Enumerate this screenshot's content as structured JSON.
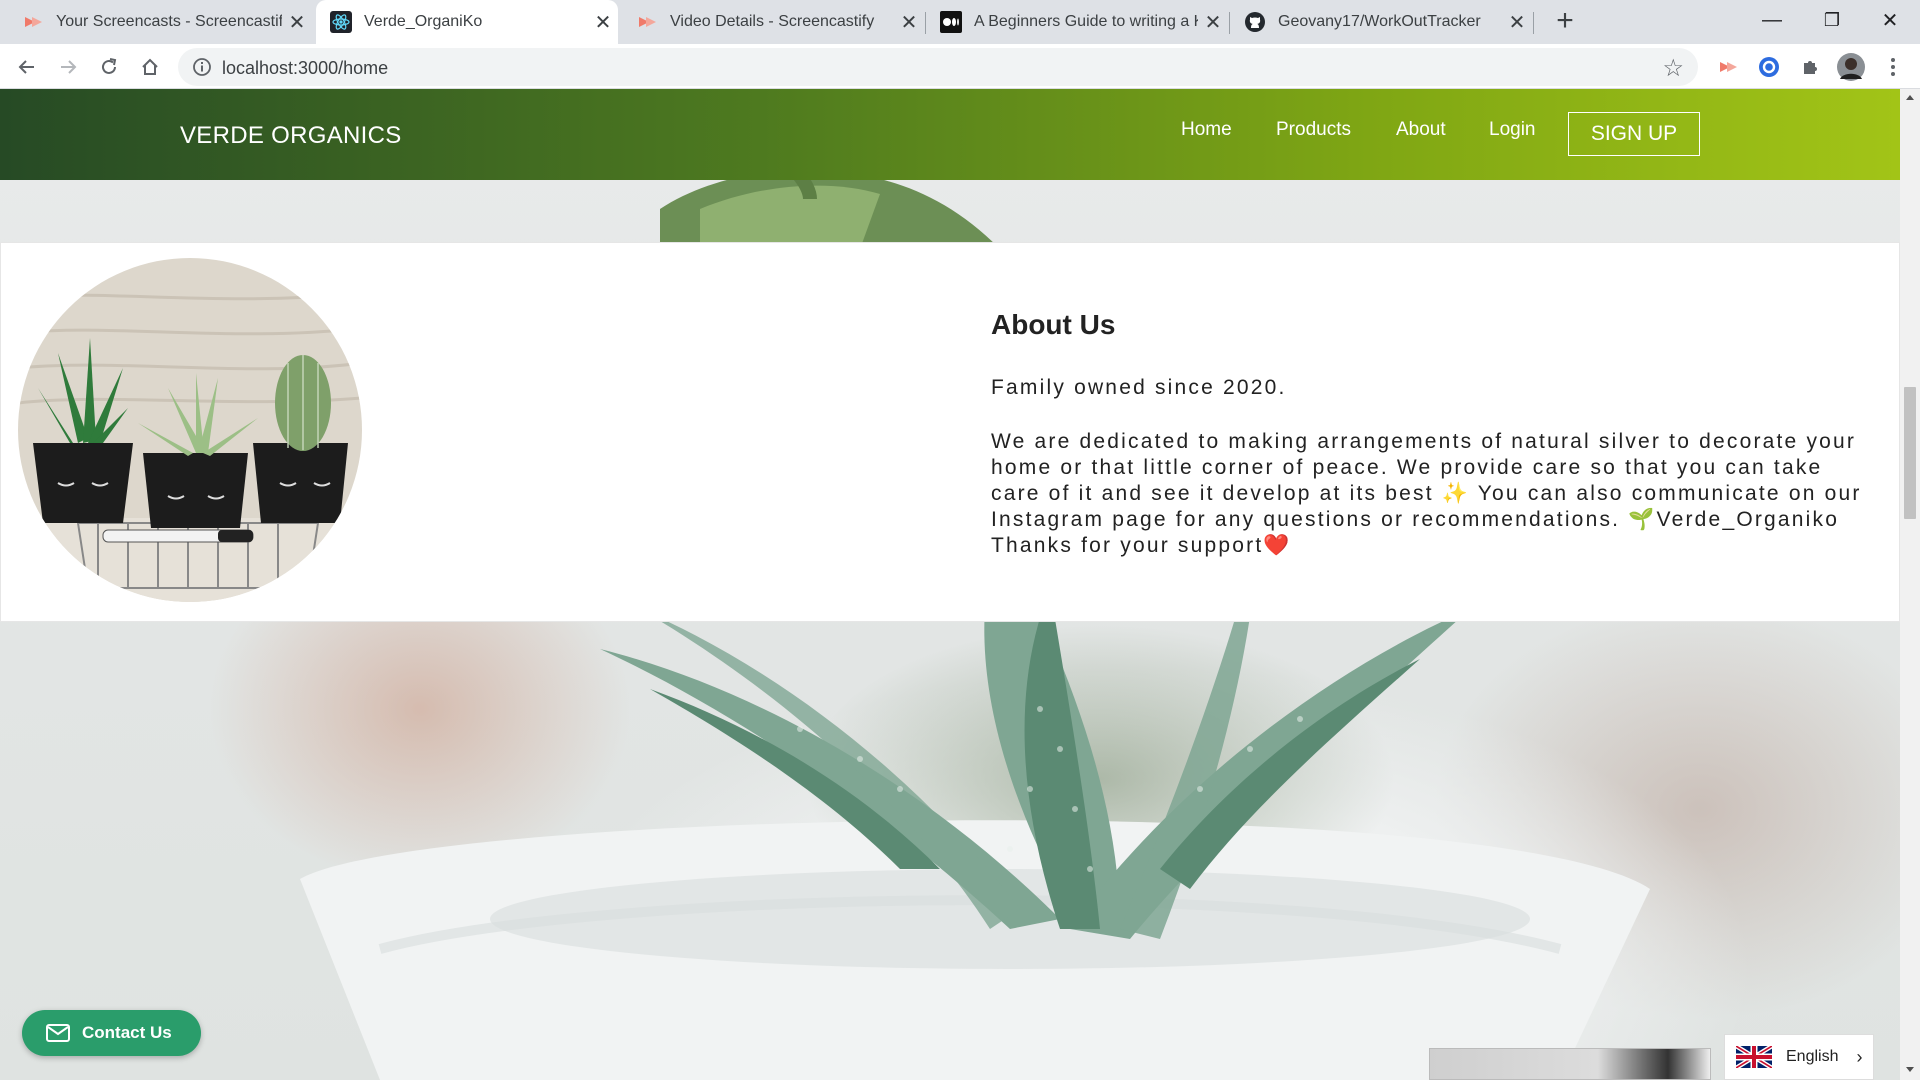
{
  "browser": {
    "tabs": [
      {
        "title": "Your Screencasts - Screencastify",
        "icon": "screencastify-icon",
        "active": false
      },
      {
        "title": "Verde_OrganiKo",
        "icon": "react-icon",
        "active": true
      },
      {
        "title": "Video Details - Screencastify",
        "icon": "screencastify-icon",
        "active": false
      },
      {
        "title": "A Beginners Guide to writing a Ki",
        "icon": "medium-icon",
        "active": false
      },
      {
        "title": "Geovany17/WorkOutTracker",
        "icon": "github-icon",
        "active": false
      }
    ],
    "new_tab_label": "+",
    "window_controls": {
      "minimize": "—",
      "restore": "❐",
      "close": "✕"
    },
    "url": "localhost:3000/home"
  },
  "site": {
    "brand": "VERDE ORGANICS",
    "nav": {
      "home": "Home",
      "products": "Products",
      "about": "About",
      "login": "Login",
      "signup": "SIGN UP"
    },
    "about": {
      "title": "About Us",
      "subtitle": "Family owned since 2020.",
      "body": "We are dedicated to making arrangements of natural silver to decorate your home or that little corner of peace. We provide care so that you can take care of it and see it develop at its best ✨ You can also communicate on our Instagram page for any questions or recommendations. 🌱Verde_Organiko Thanks for your support❤️"
    },
    "contact_button": "Contact Us",
    "language": "English"
  },
  "colors": {
    "nav_gradient_start": "#264a25",
    "nav_gradient_end": "#a2c417",
    "contact_green": "#2a9d6b"
  }
}
